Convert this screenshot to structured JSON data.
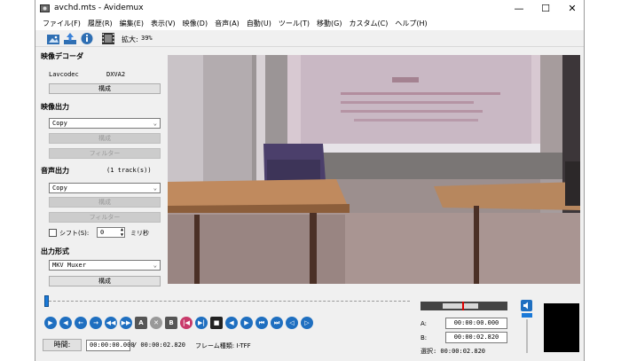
{
  "window": {
    "title": "avchd.mts - Avidemux",
    "minimize": "—",
    "maximize": "☐",
    "close": "✕"
  },
  "menubar": [
    "ファイル(F)",
    "履歴(R)",
    "編集(E)",
    "表示(V)",
    "映像(D)",
    "音声(A)",
    "自動(U)",
    "ツール(T)",
    "移動(G)",
    "カスタム(C)",
    "ヘルプ(H)"
  ],
  "toolbar": {
    "zoom_label": "拡大:",
    "zoom_value": "39%"
  },
  "video_decoder": {
    "title": "映像デコーダ",
    "codec_label": "Lavcodec",
    "codec_value": "DXVA2",
    "configure": "構成"
  },
  "video_output": {
    "title": "映像出力",
    "selected": "Copy",
    "configure": "構成",
    "filters": "フィルター"
  },
  "audio_output": {
    "title": "音声出力",
    "tracks": "(1 track(s))",
    "selected": "Copy",
    "configure": "構成",
    "filters": "フィルター",
    "shift_label": "シフト(S):",
    "shift_value": "0",
    "shift_unit": "ミリ秒"
  },
  "output_format": {
    "title": "出力形式",
    "selected": "MKV Muxer",
    "configure": "構成"
  },
  "playback": {
    "progress": 0.0
  },
  "controls": {
    "markerA": "A",
    "markerB": "B"
  },
  "status": {
    "time_button": "時間:",
    "current_time": "00:00:00.000",
    "total_time": "/ 00:00:02.820",
    "frame_type": "フレーム種類: I-TFF"
  },
  "selection": {
    "a_label": "A:",
    "a_value": "00:00:00.000",
    "b_label": "B:",
    "b_value": "00:00:02.820",
    "sel_label": "選択: 00:00:02.820"
  }
}
